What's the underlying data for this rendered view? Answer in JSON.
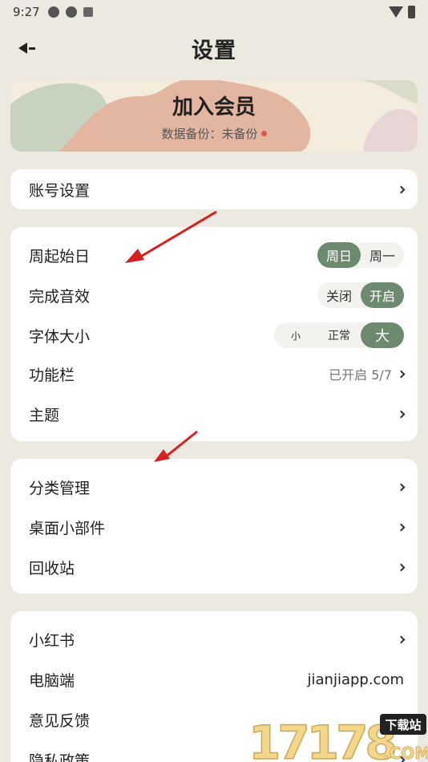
{
  "status_bar": {
    "time": "9:27",
    "icons": [
      "app-icon",
      "app-icon",
      "a-icon",
      "wifi-icon",
      "battery-icon"
    ]
  },
  "header": {
    "title": "设置",
    "back_icon": "back-arrow-icon"
  },
  "vip": {
    "title": "加入会员",
    "subtitle": "数据备份：未备份",
    "dot_color": "#e0584f"
  },
  "account": {
    "label": "账号设置"
  },
  "prefs": {
    "week_start": {
      "label": "周起始日",
      "options": [
        "周日",
        "周一"
      ],
      "selected": "周日"
    },
    "sound": {
      "label": "完成音效",
      "options": [
        "关闭",
        "开启"
      ],
      "selected": "开启"
    },
    "font_size": {
      "label": "字体大小",
      "options": [
        "小",
        "正常",
        "大"
      ],
      "selected": "大"
    },
    "toolbar": {
      "label": "功能栏",
      "value": "已开启 5/7"
    },
    "theme": {
      "label": "主题"
    }
  },
  "manage": {
    "category": {
      "label": "分类管理"
    },
    "widget": {
      "label": "桌面小部件"
    },
    "trash": {
      "label": "回收站"
    }
  },
  "about": {
    "xiaohongshu": {
      "label": "小红书"
    },
    "desktop": {
      "label": "电脑端",
      "value": "jianjiapp.com"
    },
    "feedback": {
      "label": "意见反馈"
    },
    "privacy": {
      "label": "隐私政策"
    }
  },
  "watermark": {
    "logo_text": "17178",
    "tag": "下载站",
    "suffix": ".COM"
  },
  "colors": {
    "background": "#ece9e1",
    "accent": "#6d8a6e",
    "arrow": "#d62020"
  }
}
